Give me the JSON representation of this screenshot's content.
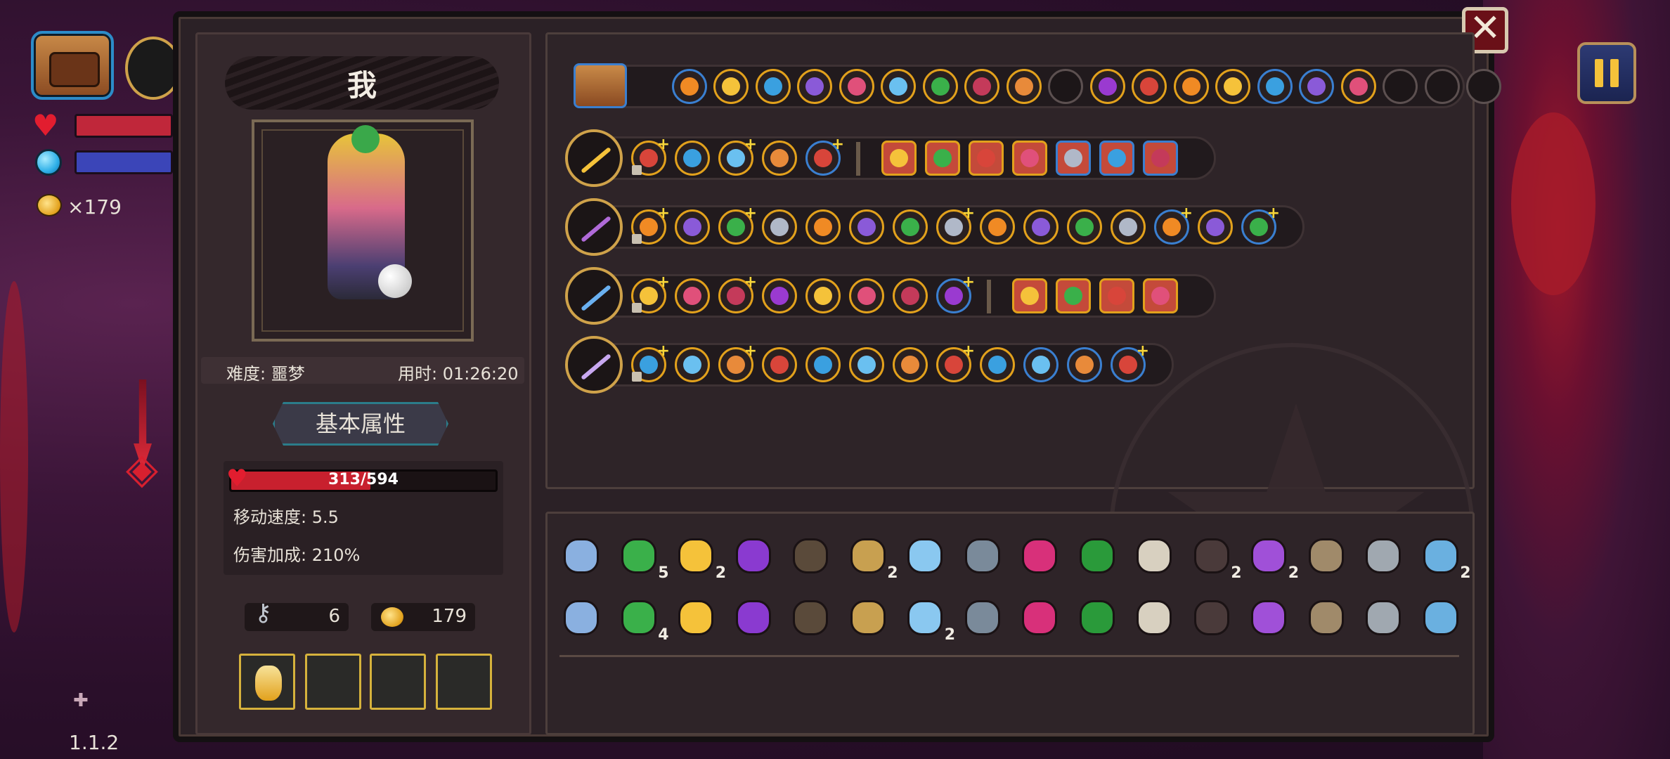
{
  "hud": {
    "coins": "×179",
    "version": "1.1.2"
  },
  "player": {
    "name": "我",
    "difficulty": "难度: 噩梦",
    "time": "用时: 01:26:20",
    "attr_title": "基本属性",
    "hp": {
      "current": 313,
      "max": 594,
      "label": "313/594"
    },
    "move_speed": "移动速度: 5.5",
    "damage_bonus": "伤害加成: 210%",
    "keys": "6",
    "coins": "179"
  },
  "colors": {
    "gold": "#e2a11c",
    "blue": "#3a7fd0",
    "hp_red": "#c8202e"
  },
  "inventory_row": {
    "icons": [
      "chest-icon",
      "sword-blue-icon",
      "flame-arrows-icon",
      "blue-wave-icon",
      "hourglass-icon",
      "red-spiral-icon",
      "yellow-swirl-icon",
      "gold-flower-icon",
      "ghost-icon",
      "fire-arrow-icon",
      "empty",
      "moon-stone-icon",
      "pink-mushroom-icon",
      "triple-arrow-icon",
      "up-arrows-icon",
      "blue-cat-icon",
      "crossed-blades-icon",
      "yellow-crescent-icon",
      "empty",
      "empty",
      "empty"
    ]
  },
  "weapon_rows": [
    {
      "weapon": "golden-sword-icon",
      "skills": 5,
      "has_sep": true,
      "extras": 7
    },
    {
      "weapon": "purple-staff-icon",
      "skills": 15,
      "has_sep": false,
      "extras": 0
    },
    {
      "weapon": "blue-scepter-icon",
      "skills": 8,
      "has_sep": true,
      "extras": 4
    },
    {
      "weapon": "star-mace-icon",
      "skills": 12,
      "has_sep": false,
      "extras": 0
    }
  ],
  "items_row1": [
    {
      "name": "blue-shield-icon",
      "count": ""
    },
    {
      "name": "clover-icon",
      "count": "5"
    },
    {
      "name": "dragonfly-icon",
      "count": "2"
    },
    {
      "name": "rainbow-cape-icon",
      "count": ""
    },
    {
      "name": "dark-hook-icon",
      "count": ""
    },
    {
      "name": "hourglass-item-icon",
      "count": "2"
    },
    {
      "name": "blue-key-icon",
      "count": ""
    },
    {
      "name": "compass-icon",
      "count": ""
    },
    {
      "name": "pink-demon-icon",
      "count": ""
    },
    {
      "name": "green-flame-icon",
      "count": ""
    },
    {
      "name": "feather-icon",
      "count": ""
    },
    {
      "name": "dark-robe-icon",
      "count": "2"
    },
    {
      "name": "purple-boot-icon",
      "count": "2"
    },
    {
      "name": "stone-tablet-icon",
      "count": ""
    },
    {
      "name": "spear-icon",
      "count": ""
    },
    {
      "name": "magnifier-icon",
      "count": "2"
    }
  ],
  "items_row2": [
    {
      "name": "antler-icon",
      "count": ""
    },
    {
      "name": "broken-sword-icon",
      "count": "4"
    },
    {
      "name": "beetle-icon",
      "count": ""
    },
    {
      "name": "scroll-icon",
      "count": ""
    },
    {
      "name": "blue-ring-icon",
      "count": ""
    },
    {
      "name": "blue-lotus-icon",
      "count": ""
    },
    {
      "name": "red-eye-icon",
      "count": "2"
    },
    {
      "name": "mirror-icon",
      "count": ""
    },
    {
      "name": "green-cube-icon",
      "count": ""
    },
    {
      "name": "ear-icon",
      "count": ""
    },
    {
      "name": "purple-rune-icon",
      "count": ""
    },
    {
      "name": "stone-claw-icon",
      "count": ""
    },
    {
      "name": "red-bird-icon",
      "count": ""
    },
    {
      "name": "purple-crystal-icon",
      "count": ""
    },
    {
      "name": "purple-cloak-icon",
      "count": ""
    },
    {
      "name": "gold-crown-icon",
      "count": ""
    }
  ]
}
